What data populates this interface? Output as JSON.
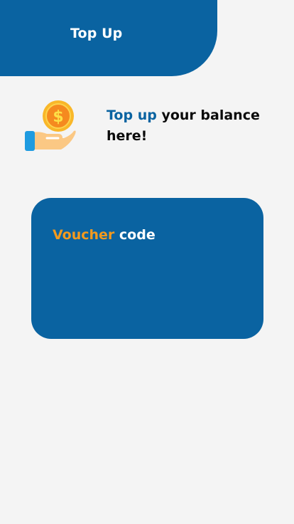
{
  "header": {
    "title": "Top Up"
  },
  "intro": {
    "icon": "coin-in-hand-icon",
    "accent_text": "Top up",
    "rest_text": " your balance here!"
  },
  "voucher": {
    "highlight_text": "Voucher",
    "rest_text": " code"
  },
  "colors": {
    "primary": "#0a63a1",
    "accent_orange": "#f39a1e",
    "background": "#f4f4f4",
    "text_dark": "#0b0b0b",
    "coin": "#f9b729",
    "hand_skin": "#fbc884",
    "cuff": "#1e9be0"
  }
}
